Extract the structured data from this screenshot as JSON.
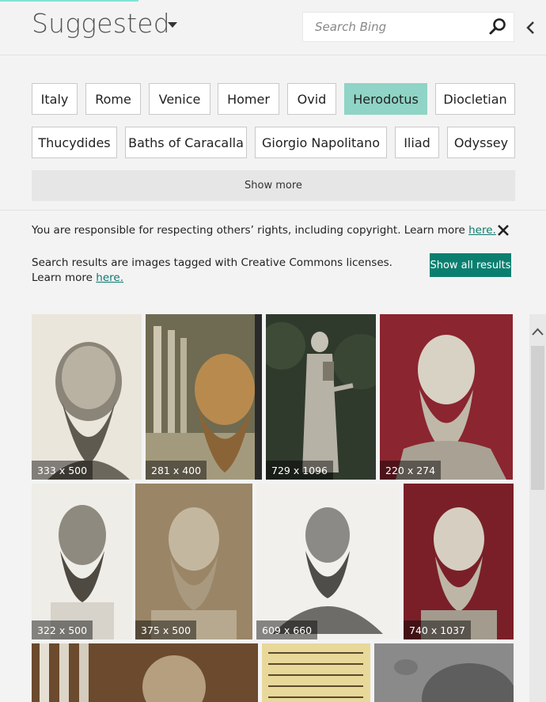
{
  "header": {
    "title": "Suggested",
    "search_placeholder": "Search Bing"
  },
  "chips": {
    "row1": [
      "Italy",
      "Rome",
      "Venice",
      "Homer",
      "Ovid",
      "Herodotus",
      "Diocletian"
    ],
    "row2": [
      "Thucydides",
      "Baths of Caracalla",
      "Giorgio Napolitano",
      "Iliad",
      "Odyssey"
    ],
    "active": "Herodotus",
    "show_more": "Show more"
  },
  "notice": {
    "text": "You are responsible for respecting others’ rights, including copyright. Learn more ",
    "link": "here."
  },
  "cc": {
    "text": "Search results are images tagged with Creative Commons licenses. Learn more ",
    "link": "here.",
    "button": "Show all results"
  },
  "results": [
    {
      "dims": "333 x 500"
    },
    {
      "dims": "281 x 400"
    },
    {
      "dims": "729 x 1096"
    },
    {
      "dims": "220 x 274"
    },
    {
      "dims": "322 x 500"
    },
    {
      "dims": "375 x 500"
    },
    {
      "dims": "609 x 660"
    },
    {
      "dims": "740 x 1037"
    }
  ],
  "colors": {
    "accent": "#0a7f70",
    "active_chip": "#8fd4c6",
    "link": "#0b7a6e"
  },
  "icons": [
    "search-icon",
    "chevron-left-icon",
    "close-icon",
    "chevron-up-icon",
    "dropdown-caret-icon"
  ]
}
